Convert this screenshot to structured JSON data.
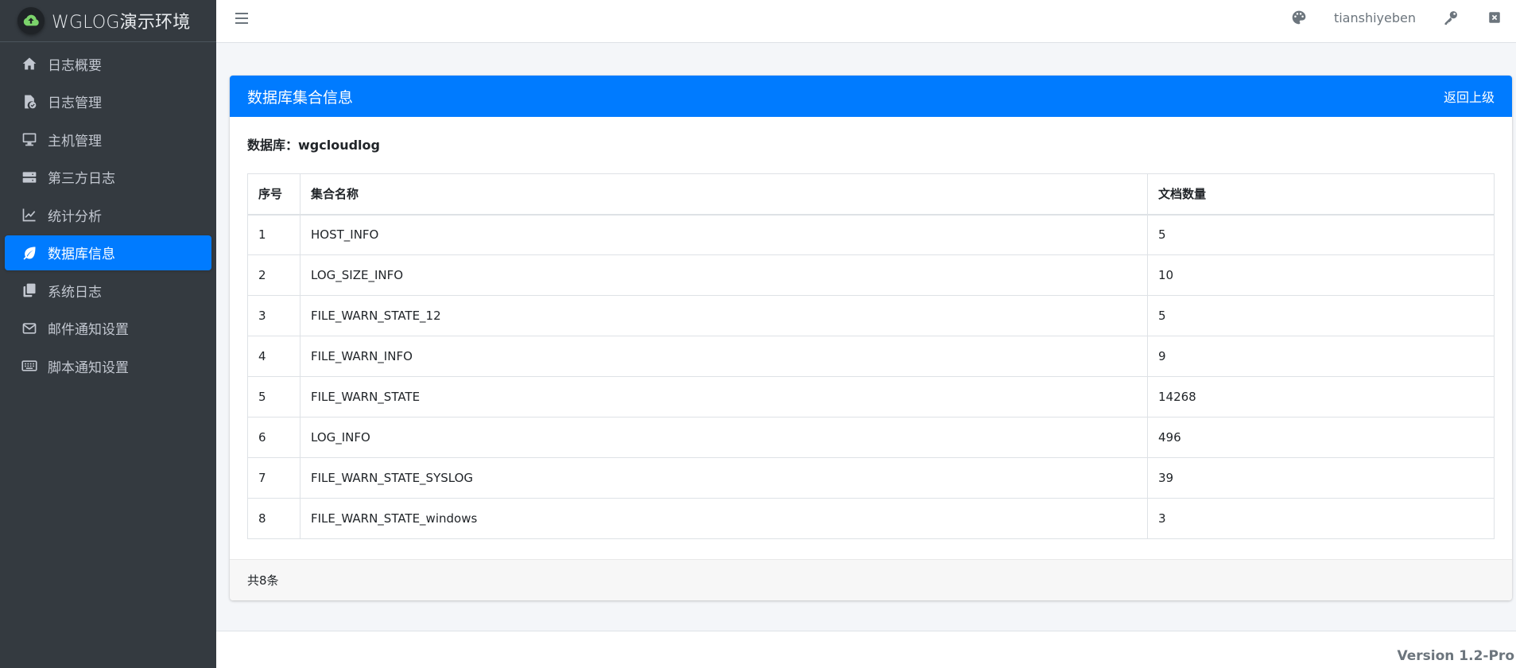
{
  "brand": {
    "title": "WGLOG演示环境"
  },
  "sidebar": {
    "items": [
      {
        "label": "日志概要",
        "icon": "home-icon",
        "active": false
      },
      {
        "label": "日志管理",
        "icon": "file-check-icon",
        "active": false
      },
      {
        "label": "主机管理",
        "icon": "desktop-icon",
        "active": false
      },
      {
        "label": "第三方日志",
        "icon": "server-icon",
        "active": false
      },
      {
        "label": "统计分析",
        "icon": "line-chart-icon",
        "active": false
      },
      {
        "label": "数据库信息",
        "icon": "leaf-icon",
        "active": true
      },
      {
        "label": "系统日志",
        "icon": "copy-icon",
        "active": false
      },
      {
        "label": "邮件通知设置",
        "icon": "envelope-icon",
        "active": false
      },
      {
        "label": "脚本通知设置",
        "icon": "keyboard-icon",
        "active": false
      }
    ]
  },
  "header": {
    "username": "tianshiyeben"
  },
  "card": {
    "title": "数据库集合信息",
    "back_label": "返回上级",
    "db_label": "数据库：wgcloudlog",
    "columns": [
      "序号",
      "集合名称",
      "文档数量"
    ],
    "rows": [
      [
        "1",
        "HOST_INFO",
        "5"
      ],
      [
        "2",
        "LOG_SIZE_INFO",
        "10"
      ],
      [
        "3",
        "FILE_WARN_STATE_12",
        "5"
      ],
      [
        "4",
        "FILE_WARN_INFO",
        "9"
      ],
      [
        "5",
        "FILE_WARN_STATE",
        "14268"
      ],
      [
        "6",
        "LOG_INFO",
        "496"
      ],
      [
        "7",
        "FILE_WARN_STATE_SYSLOG",
        "39"
      ],
      [
        "8",
        "FILE_WARN_STATE_windows",
        "3"
      ]
    ],
    "footer_text": "共8条"
  },
  "footer": {
    "version": "Version 1.2-Pro"
  },
  "colors": {
    "sidebar_bg": "#343a40",
    "accent": "#007bff",
    "page_bg": "#f4f6f9"
  }
}
